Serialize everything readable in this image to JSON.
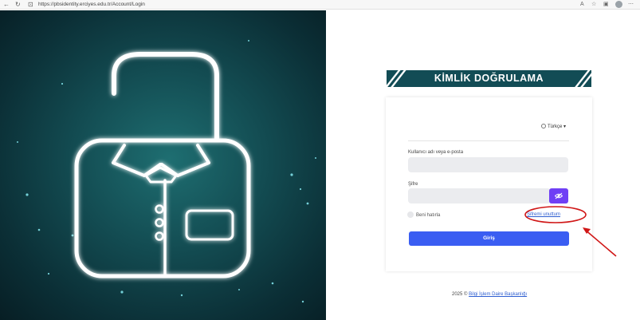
{
  "browser": {
    "url": "https://pbsidentity.erciyes.edu.tr/Account/Login",
    "back_icon": "back-arrow-icon",
    "reload_icon": "reload-icon",
    "lock_icon": "lock-icon"
  },
  "hero": {
    "icon": "unlocked-padlock-icon",
    "accent_color": "#ffffff",
    "background_color": "#134c52"
  },
  "banner": {
    "title": "KİMLİK DOĞRULAMA",
    "background_color": "#124c55"
  },
  "language": {
    "selected": "Türkçe"
  },
  "form": {
    "username_label": "Kullanıcı adı veya e-posta",
    "username_value": "",
    "password_label": "Şifre",
    "password_value": "",
    "show_password_icon": "eye-slash-icon",
    "remember_label": "Beni hatırla",
    "forgot_label": "Şifremi unuttum",
    "login_label": "Giriş",
    "primary_color": "#3a5df2",
    "accent_color": "#6f3ff5"
  },
  "footer": {
    "year": "2025 ©",
    "org": "Bilgi İşlem Daire Başkanlığı"
  }
}
